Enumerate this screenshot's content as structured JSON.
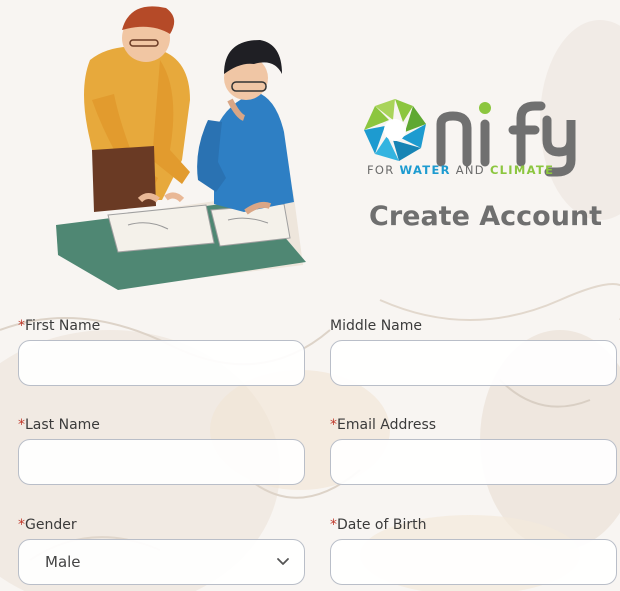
{
  "brand": {
    "name": "nify",
    "tagline_prefix": "FOR",
    "tagline_water": "WATER",
    "tagline_and": "AND",
    "tagline_climate": "CLIMATE",
    "colors": {
      "blue": "#1d9bd0",
      "green": "#8cc63f",
      "gray": "#6b6b6b"
    }
  },
  "page": {
    "title": "Create Account"
  },
  "form": {
    "required_marker": "*",
    "first_name": {
      "label": "First Name",
      "value": "",
      "required": true
    },
    "middle_name": {
      "label": "Middle Name",
      "value": "",
      "required": false
    },
    "last_name": {
      "label": "Last Name",
      "value": "",
      "required": true
    },
    "email": {
      "label": "Email Address",
      "value": "",
      "required": true
    },
    "gender": {
      "label": "Gender",
      "value": "Male",
      "required": true
    },
    "dob": {
      "label": "Date of Birth",
      "value": "",
      "required": true
    }
  },
  "icons": {
    "select_arrow": "chevron-down-icon"
  }
}
